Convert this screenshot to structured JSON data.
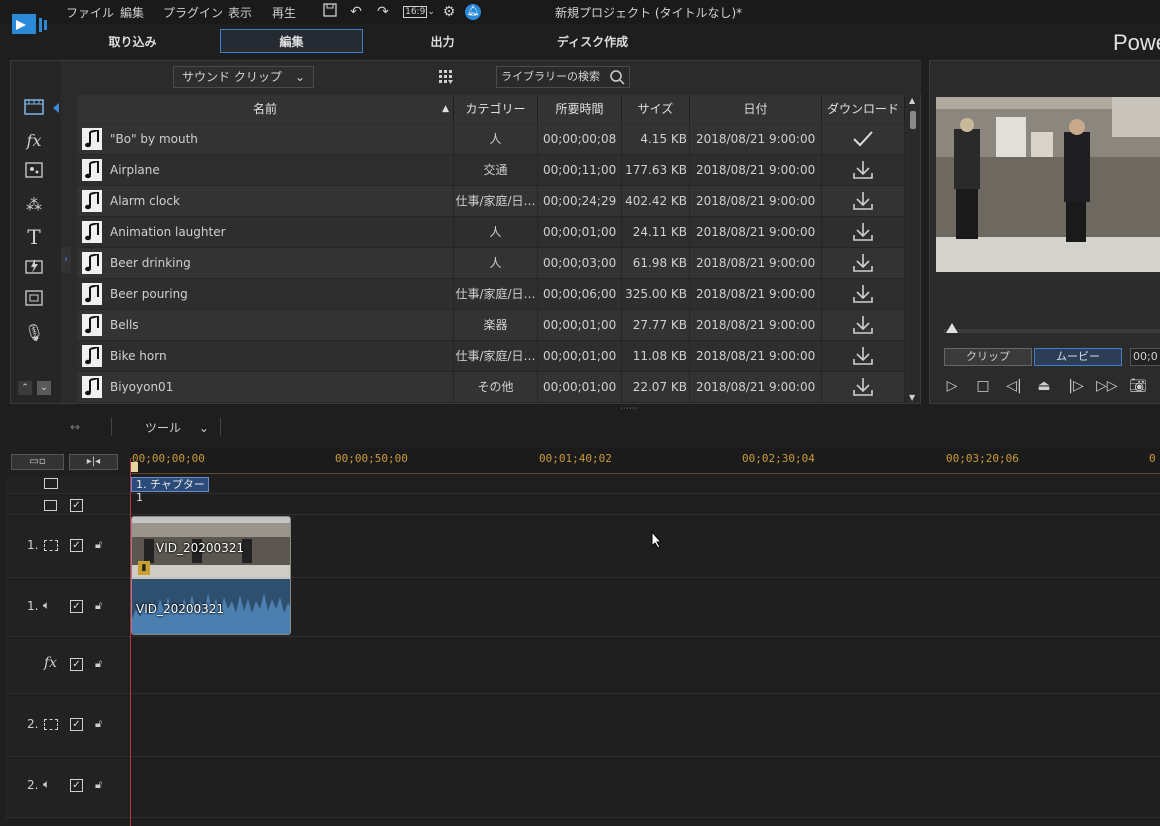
{
  "window": {
    "title": "新規プロジェクト (タイトルなし)*"
  },
  "menu": [
    "ファイル",
    "編集",
    "プラグイン",
    "表示",
    "再生"
  ],
  "toolbar": {
    "aspect": "16:9"
  },
  "modes": [
    {
      "label": "取り込み",
      "active": false
    },
    {
      "label": "編集",
      "active": true
    },
    {
      "label": "出力",
      "active": false
    },
    {
      "label": "ディスク作成",
      "active": false
    }
  ],
  "brand": "Powe",
  "library": {
    "category_select": "サウンド クリップ",
    "search_placeholder": "ライブラリーの検索",
    "columns": [
      "名前",
      "カテゴリー",
      "所要時間",
      "サイズ",
      "日付",
      "ダウンロード"
    ],
    "rows": [
      {
        "name": "\"Bo\" by mouth",
        "category": "人",
        "duration": "00;00;00;08",
        "size": "4.15 KB",
        "date": "2018/08/21 9:00:00",
        "downloaded": true
      },
      {
        "name": "Airplane",
        "category": "交通",
        "duration": "00;00;11;00",
        "size": "177.63 KB",
        "date": "2018/08/21 9:00:00",
        "downloaded": false
      },
      {
        "name": "Alarm clock",
        "category": "仕事/家庭/日…",
        "duration": "00;00;24;29",
        "size": "402.42 KB",
        "date": "2018/08/21 9:00:00",
        "downloaded": false
      },
      {
        "name": "Animation laughter",
        "category": "人",
        "duration": "00;00;01;00",
        "size": "24.11 KB",
        "date": "2018/08/21 9:00:00",
        "downloaded": false
      },
      {
        "name": "Beer drinking",
        "category": "人",
        "duration": "00;00;03;00",
        "size": "61.98 KB",
        "date": "2018/08/21 9:00:00",
        "downloaded": false
      },
      {
        "name": "Beer pouring",
        "category": "仕事/家庭/日…",
        "duration": "00;00;06;00",
        "size": "325.00 KB",
        "date": "2018/08/21 9:00:00",
        "downloaded": false
      },
      {
        "name": "Bells",
        "category": "楽器",
        "duration": "00;00;01;00",
        "size": "27.77 KB",
        "date": "2018/08/21 9:00:00",
        "downloaded": false
      },
      {
        "name": "Bike horn",
        "category": "仕事/家庭/日…",
        "duration": "00;00;01;00",
        "size": "11.08 KB",
        "date": "2018/08/21 9:00:00",
        "downloaded": false
      },
      {
        "name": "Biyoyon01",
        "category": "その他",
        "duration": "00;00;01;00",
        "size": "22.07 KB",
        "date": "2018/08/21 9:00:00",
        "downloaded": false
      }
    ]
  },
  "preview": {
    "tab_clip": "クリップ",
    "tab_movie": "ムービー",
    "timecode": "00;0"
  },
  "timeline": {
    "tools_label": "ツール",
    "ruler": [
      "00;00;00;00",
      "00;00;50;00",
      "00;01;40;02",
      "00;02;30;04",
      "00;03;20;06",
      "0"
    ],
    "chapter": "1. チャプター 1",
    "track_labels": [
      "1.",
      "1.",
      "2.",
      "2."
    ],
    "clip_name": "VID_20200321",
    "clip_audio_name": "VID_20200321"
  }
}
